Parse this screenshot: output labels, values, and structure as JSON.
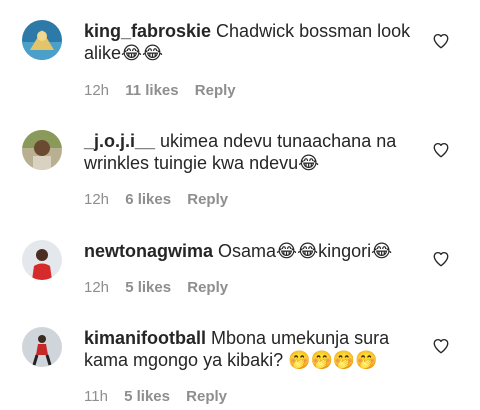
{
  "comments": [
    {
      "username": "king_fabroskie",
      "text": " Chadwick bossman look alike😂😂",
      "time": "12h",
      "likes": "11 likes",
      "reply": "Reply",
      "avatar_color": "#3b8fb8"
    },
    {
      "username": "_j.o.j.i__",
      "text": " ukimea ndevu tunaachana na wrinkles tuingie kwa ndevu😂",
      "time": "12h",
      "likes": "6 likes",
      "reply": "Reply",
      "avatar_color": "#7a8a50"
    },
    {
      "username": "newtonagwima",
      "text": " Osama😂😂kingori😂",
      "time": "12h",
      "likes": "5 likes",
      "reply": "Reply",
      "avatar_color": "#d8dde2"
    },
    {
      "username": "kimanifootball",
      "text": " Mbona umekunja sura kama mgongo ya kibaki? 🤭🤭🤭🤭",
      "time": "11h",
      "likes": "5 likes",
      "reply": "Reply",
      "avatar_color": "#c9d0d6"
    }
  ]
}
